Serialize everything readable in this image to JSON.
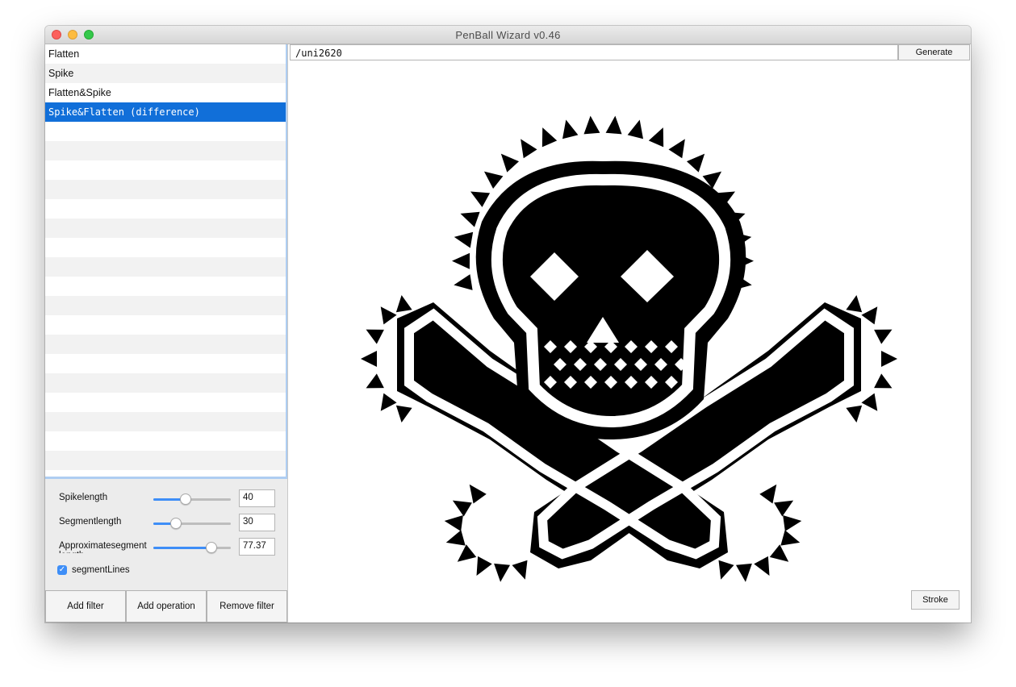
{
  "window": {
    "title": "PenBall Wizard v0.46"
  },
  "filters": {
    "items": [
      {
        "label": "Flatten",
        "selected": false
      },
      {
        "label": "Spike",
        "selected": false
      },
      {
        "label": "Flatten&Spike",
        "selected": false
      },
      {
        "label": "Spike&Flatten (difference)",
        "selected": true
      }
    ]
  },
  "params": {
    "spikelength": {
      "label": "Spikelength",
      "value": "40",
      "level": 0.42
    },
    "segmentlength": {
      "label": "Segmentlength",
      "value": "30",
      "level": 0.29
    },
    "approxsegment": {
      "label": "Approximatesegment length",
      "value": "77.37",
      "level": 0.75
    },
    "segmentlines": {
      "label": "segmentLines",
      "checked": true
    }
  },
  "buttons": {
    "add_filter": "Add filter",
    "add_operation": "Add operation",
    "remove_filter": "Remove filter",
    "generate": "Generate",
    "stroke": "Stroke"
  },
  "glyph_input": {
    "value": "/uni2620"
  },
  "colors": {
    "accent": "#116fd9",
    "slider_fill": "#3e8ef7"
  },
  "preview": {
    "glyph": "skull-and-crossbones"
  }
}
